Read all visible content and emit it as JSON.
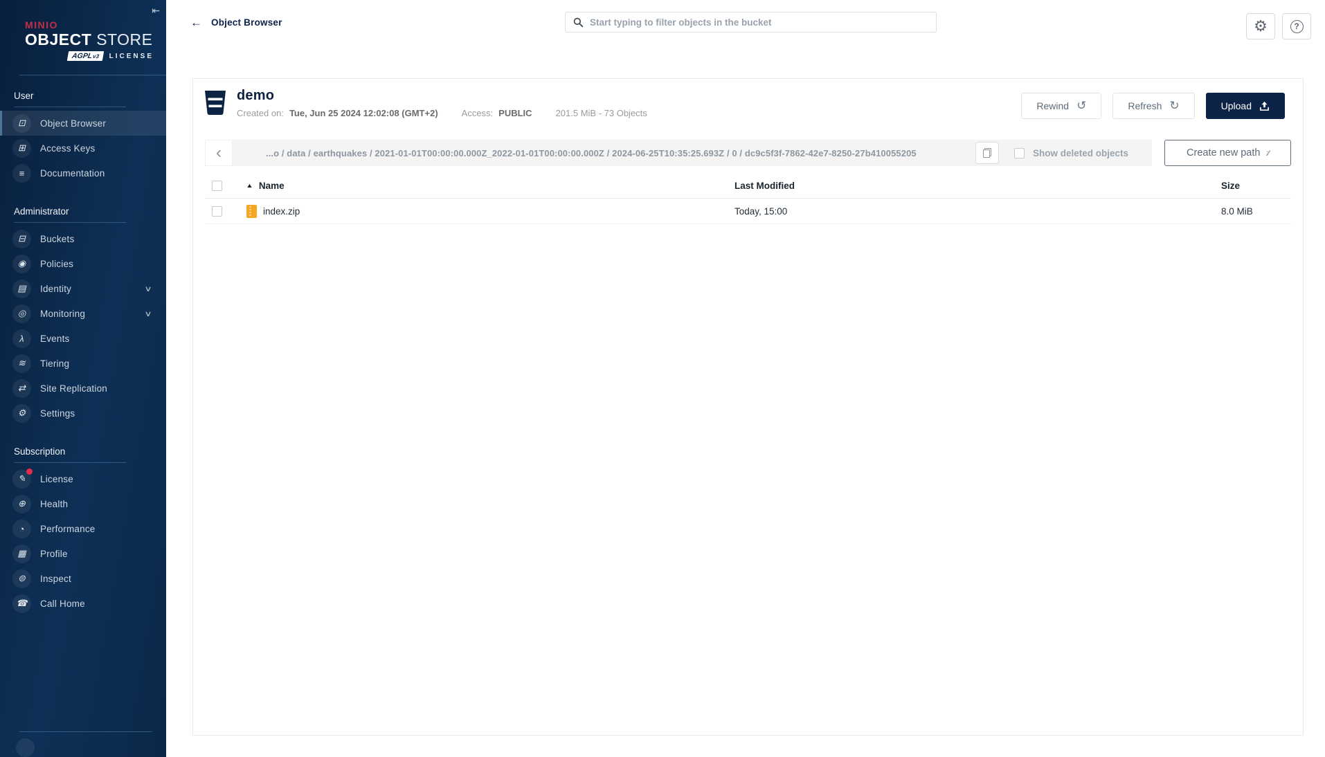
{
  "brand": {
    "name": "MINIO",
    "product_word1": "OBJECT",
    "product_word2": "STORE",
    "badge": "AGPL",
    "badge_version": "v3",
    "license_label": "LICENSE"
  },
  "icons": {
    "collapse_glyph": "⇤",
    "back_glyph": "←",
    "gear_glyph": "⚙",
    "help_glyph": "?",
    "rewind_glyph": "↺",
    "refresh_glyph": "↻",
    "chevron_left_glyph": "‹",
    "sort_asc_glyph": "▲",
    "create_path_glyph": "∶∕∕"
  },
  "sidebar": {
    "sections": [
      {
        "label": "User",
        "items": [
          {
            "label": "Object Browser",
            "glyph": "⊡"
          },
          {
            "label": "Access Keys",
            "glyph": "⊞"
          },
          {
            "label": "Documentation",
            "glyph": "≡"
          }
        ]
      },
      {
        "label": "Administrator",
        "items": [
          {
            "label": "Buckets",
            "glyph": "⊟"
          },
          {
            "label": "Policies",
            "glyph": "◉"
          },
          {
            "label": "Identity",
            "glyph": "▤",
            "chevron": "∨"
          },
          {
            "label": "Monitoring",
            "glyph": "◎",
            "chevron": "∨"
          },
          {
            "label": "Events",
            "glyph": "λ"
          },
          {
            "label": "Tiering",
            "glyph": "≋"
          },
          {
            "label": "Site Replication",
            "glyph": "⇄"
          },
          {
            "label": "Settings",
            "glyph": "⚙"
          }
        ]
      },
      {
        "label": "Subscription",
        "items": [
          {
            "label": "License",
            "glyph": "✎"
          },
          {
            "label": "Health",
            "glyph": "⊕"
          },
          {
            "label": "Performance",
            "glyph": "◔"
          },
          {
            "label": "Profile",
            "glyph": "▦"
          },
          {
            "label": "Inspect",
            "glyph": "⊜"
          },
          {
            "label": "Call Home",
            "glyph": "☎"
          }
        ]
      }
    ]
  },
  "header": {
    "title": "Object Browser",
    "search_placeholder": "Start typing to filter objects in the bucket"
  },
  "bucket": {
    "name": "demo",
    "created_label": "Created on:",
    "created_value": "Tue, Jun 25 2024 12:02:08 (GMT+2)",
    "access_label": "Access:",
    "access_value": "PUBLIC",
    "stats": "201.5 MiB - 73 Objects",
    "rewind_label": "Rewind",
    "refresh_label": "Refresh",
    "upload_label": "Upload"
  },
  "breadcrumb": {
    "path": "...o / data / earthquakes / 2021-01-01T00:00:00.000Z_2022-01-01T00:00:00.000Z / 2024-06-25T10:35:25.693Z / 0 / dc9c5f3f-7862-42e7-8250-27b410055205",
    "show_deleted_label": "Show deleted objects",
    "create_path_label": "Create new path"
  },
  "table": {
    "columns": [
      "Name",
      "Last Modified",
      "Size"
    ],
    "rows": [
      {
        "name": "index.zip",
        "last_modified": "Today, 15:00",
        "size": "8.0 MiB"
      }
    ]
  },
  "colors": {
    "brand_red": "#C72C48",
    "navy": "#0b2347",
    "sidebar_top": "#081f3c",
    "sidebar_mid": "#0e3056",
    "zip_orange": "#f5a623",
    "alert_red": "#e22b4e",
    "breadcrumb_bg": "#f4f4f4"
  }
}
